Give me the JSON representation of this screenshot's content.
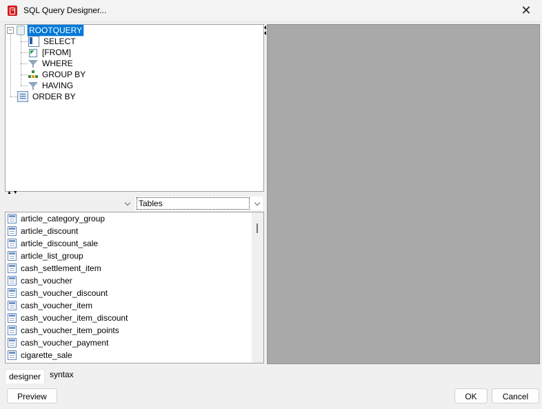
{
  "window": {
    "title": "SQL Query Designer..."
  },
  "tree": {
    "root": "ROOTQUERY",
    "children": [
      "SELECT",
      "[FROM]",
      "WHERE",
      "GROUP BY",
      "HAVING"
    ],
    "order_by": "ORDER BY"
  },
  "source_combo": {
    "left_value": "",
    "right_value": "Tables"
  },
  "tables": [
    "article_category_group",
    "article_discount",
    "article_discount_sale",
    "article_list_group",
    "cash_settlement_item",
    "cash_voucher",
    "cash_voucher_discount",
    "cash_voucher_item",
    "cash_voucher_item_discount",
    "cash_voucher_item_points",
    "cash_voucher_payment",
    "cigarette_sale"
  ],
  "tabs": [
    {
      "label": "designer",
      "active": true
    },
    {
      "label": "syntax",
      "active": false
    }
  ],
  "buttons": {
    "preview": "Preview",
    "ok": "OK",
    "cancel": "Cancel"
  },
  "colors": {
    "selection": "#0078d7",
    "preview_bg": "#a9a9a9"
  }
}
